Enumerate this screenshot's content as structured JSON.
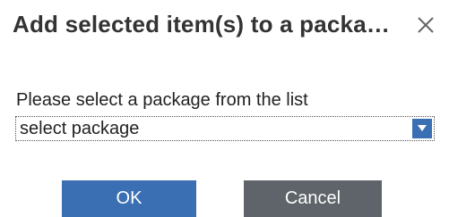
{
  "dialog": {
    "title": "Add selected item(s) to a packa…",
    "close_icon": "close-icon"
  },
  "form": {
    "label": "Please select a package from the list",
    "select_value": "select package",
    "dropdown_icon": "chevron-down-icon"
  },
  "buttons": {
    "ok_label": "OK",
    "cancel_label": "Cancel"
  },
  "colors": {
    "primary": "#3a6fb4",
    "secondary": "#5e6469",
    "title_text": "#333333"
  }
}
